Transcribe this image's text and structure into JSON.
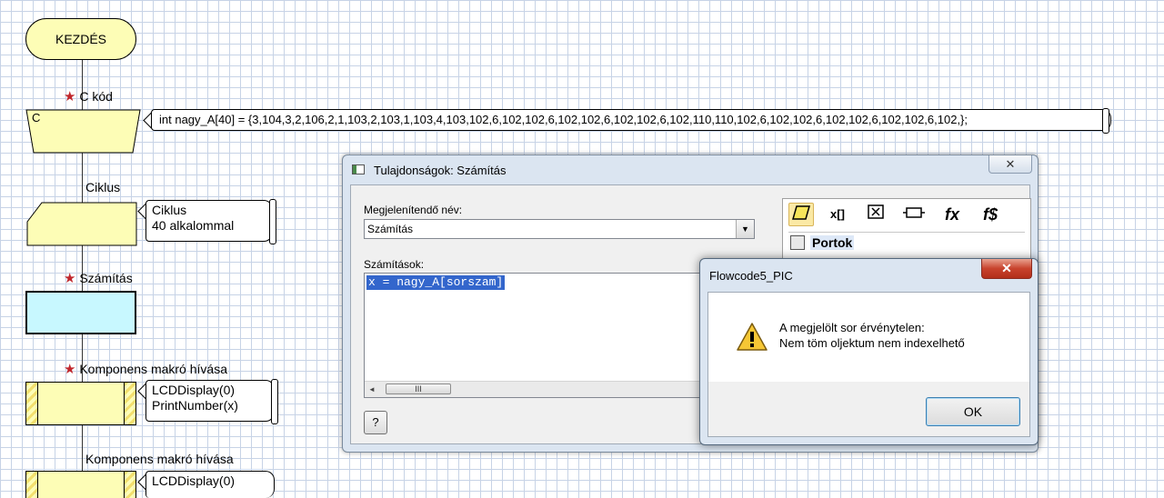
{
  "flowchart": {
    "start_label": "KEZDÉS",
    "c_code": {
      "caption": "C kód",
      "shape_text": "C",
      "code": "int nagy_A[40] = {3,104,3,2,106,2,1,103,2,103,1,103,4,103,102,6,102,102,6,102,102,6,102,102,6,102,110,110,102,6,102,102,6,102,102,6,102,102,6,102,};"
    },
    "loop": {
      "caption": "Ciklus",
      "comment_line1": "Ciklus",
      "comment_line2": "40 alkalommal"
    },
    "calc": {
      "caption": "Számítás"
    },
    "macro1": {
      "caption": "Komponens makró hívása",
      "line1": "LCDDisplay(0)",
      "line2": "PrintNumber(x)"
    },
    "macro2": {
      "caption": "Komponens makró hívása",
      "line1": "LCDDisplay(0)"
    }
  },
  "properties_dialog": {
    "title": "Tulajdonságok: Számítás",
    "close_glyph": "✕",
    "display_name_label": "Megjelenítendő név:",
    "display_name_value": "Számítás",
    "calculations_label": "Számítások:",
    "calculation_text": "x = nagy_A[sorszam]",
    "scroll_thumb_glyph": "III",
    "help_button": "?",
    "tree_item": "Portok",
    "tools": [
      "variable-tool",
      "array-tool",
      "delete-tool",
      "port-tool",
      "function-tool",
      "string-function-tool"
    ]
  },
  "error_dialog": {
    "title": "Flowcode5_PIC",
    "close_glyph": "✕",
    "icon": "warning-icon",
    "message_line1": "A megjelölt sor érvénytelen:",
    "message_line2": "Nem töm oljektum nem indexelhető",
    "ok_label": "OK"
  },
  "colors": {
    "flow_yellow": "#fdfdb6",
    "calc_cyan": "#c8f8ff",
    "star_red": "#c0262c",
    "selection_blue": "#3366cc",
    "close_red": "#c8432d"
  }
}
